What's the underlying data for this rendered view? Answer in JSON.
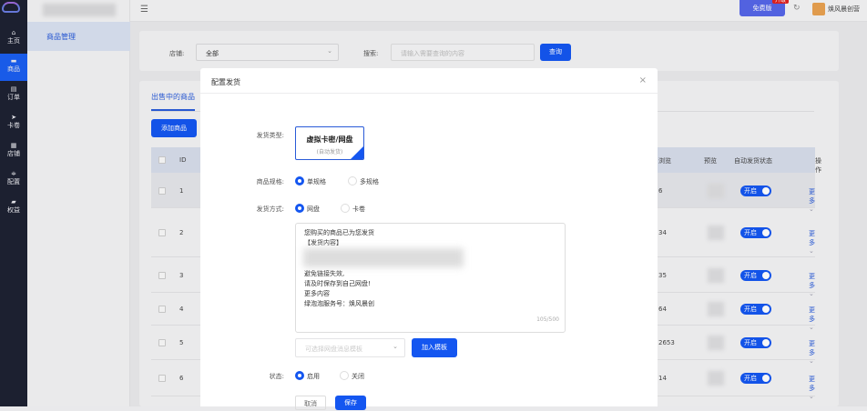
{
  "rail": {
    "items": [
      {
        "label": "主页",
        "icon": "home-icon"
      },
      {
        "label": "商品",
        "icon": "goods-icon"
      },
      {
        "label": "订单",
        "icon": "order-icon"
      },
      {
        "label": "卡卷",
        "icon": "send-icon"
      },
      {
        "label": "店铺",
        "icon": "grid-icon"
      },
      {
        "label": "配置",
        "icon": "config-icon"
      },
      {
        "label": "权益",
        "icon": "benefit-icon"
      }
    ],
    "active": 1
  },
  "sidebar": {
    "item": "商品管理"
  },
  "topbar": {
    "menu_icon": "☰",
    "plan": "免费版",
    "badge": "升级",
    "refresh_icon": "↻",
    "user": "焕风晨创营"
  },
  "filter": {
    "shop_label": "店铺:",
    "shop_value": "全部",
    "search_label": "搜索:",
    "search_placeholder": "请输入需要查询的内容",
    "query": "查询"
  },
  "panel": {
    "tab": "出售中的商品",
    "add": "添加商品",
    "columns": {
      "id": "ID",
      "views": "浏览",
      "preview": "预览",
      "auto": "自动发货状态",
      "ops": "操作"
    },
    "rows": [
      {
        "id": "1",
        "views": "6"
      },
      {
        "id": "2",
        "views": "34"
      },
      {
        "id": "3",
        "views": "35"
      },
      {
        "id": "4",
        "views": "64"
      },
      {
        "id": "5",
        "views": "2653"
      },
      {
        "id": "6",
        "views": "14"
      }
    ],
    "switch_label": "开启",
    "more": "更多"
  },
  "modal": {
    "title": "配置发货",
    "close": "×",
    "type_label": "发货类型:",
    "type_title": "虚拟卡密/网盘",
    "type_sub": "(自动发货)",
    "spec_label": "商品规格:",
    "spec_single": "单规格",
    "spec_multi": "多规格",
    "method_label": "发货方式:",
    "method_pan": "网盘",
    "method_card": "卡卷",
    "content_lines": [
      "您购买的商品已为您发货",
      "【发货内容】",
      "",
      "",
      "避免链接失效,",
      "请及时保存到自己网盘!",
      "更多内容",
      "绿泡泡服务号：焕风晨创"
    ],
    "count": "105/500",
    "template_placeholder": "可选择网盘消息模板",
    "add_template": "加入模板",
    "status_label": "状态:",
    "status_on": "启用",
    "status_off": "关闭",
    "cancel": "取消",
    "save": "保存"
  }
}
